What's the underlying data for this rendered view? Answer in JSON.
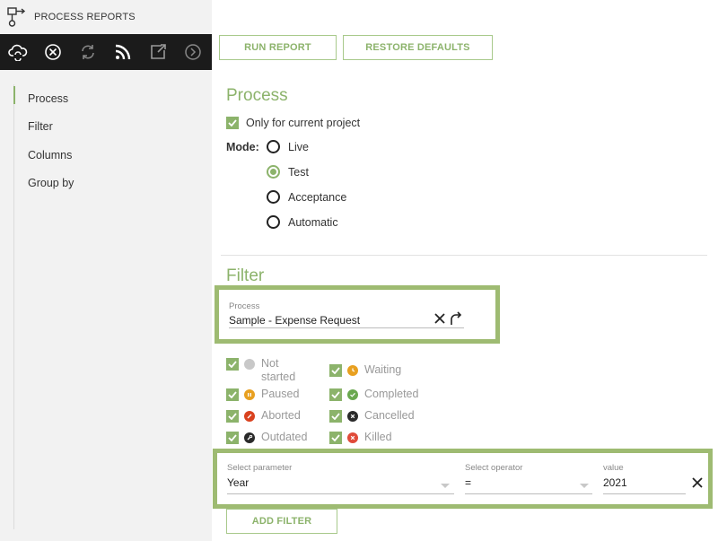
{
  "app": {
    "title": "PROCESS REPORTS",
    "logo_icon": "process-flow-icon"
  },
  "toolbar": {
    "items": [
      {
        "name": "cloud-sync-icon",
        "label": ""
      },
      {
        "name": "cancel-circle-icon",
        "label": ""
      },
      {
        "name": "refresh-icon",
        "label": ""
      },
      {
        "name": "rss-feed-icon",
        "label": ""
      },
      {
        "name": "export-icon",
        "label": ""
      },
      {
        "name": "forward-circle-icon",
        "label": ""
      }
    ]
  },
  "sidenav": {
    "items": [
      {
        "label": "Process",
        "active": true
      },
      {
        "label": "Filter",
        "active": false
      },
      {
        "label": "Columns",
        "active": false
      },
      {
        "label": "Group by",
        "active": false
      }
    ]
  },
  "actions": {
    "run_report": "RUN REPORT",
    "restore_defaults": "RESTORE DEFAULTS",
    "add_filter": "ADD FILTER"
  },
  "process_section": {
    "title": "Process",
    "only_current_project": {
      "label": "Only for current project",
      "checked": true
    },
    "mode": {
      "label": "Mode:",
      "options": [
        "Live",
        "Test",
        "Acceptance",
        "Automatic"
      ],
      "selected": "Test"
    }
  },
  "filter_section": {
    "title": "Filter",
    "process_field": {
      "label": "Process",
      "value": "Sample - Expense Request"
    },
    "statuses": [
      {
        "label": "Not started",
        "line1": "Not",
        "line2": "started",
        "checked": true,
        "color": "#c8c8c8",
        "icon": "circle-icon"
      },
      {
        "label": "Waiting",
        "checked": true,
        "color": "#e8a020",
        "icon": "clock-icon"
      },
      {
        "label": "Paused",
        "checked": true,
        "color": "#e8a020",
        "icon": "pause-icon"
      },
      {
        "label": "Completed",
        "checked": true,
        "color": "#6aa84f",
        "icon": "check-icon"
      },
      {
        "label": "Aborted",
        "checked": true,
        "color": "#d9411e",
        "icon": "slash-icon"
      },
      {
        "label": "Cancelled",
        "checked": true,
        "color": "#2a2a2a",
        "icon": "x-icon"
      },
      {
        "label": "Outdated",
        "checked": true,
        "color": "#2a2a2a",
        "icon": "wrench-icon"
      },
      {
        "label": "Killed",
        "checked": true,
        "color": "#e04b3a",
        "icon": "x-icon"
      }
    ],
    "parameter_row": {
      "parameter_label": "Select parameter",
      "parameter_value": "Year",
      "operator_label": "Select operator",
      "operator_value": "=",
      "value_label": "value",
      "value": "2021"
    }
  },
  "colors": {
    "accent": "#8cb36b",
    "highlight_border": "#9ebb72",
    "toolbar_bg": "#1b1b1b",
    "sidebar_bg": "#f2f2f2"
  }
}
